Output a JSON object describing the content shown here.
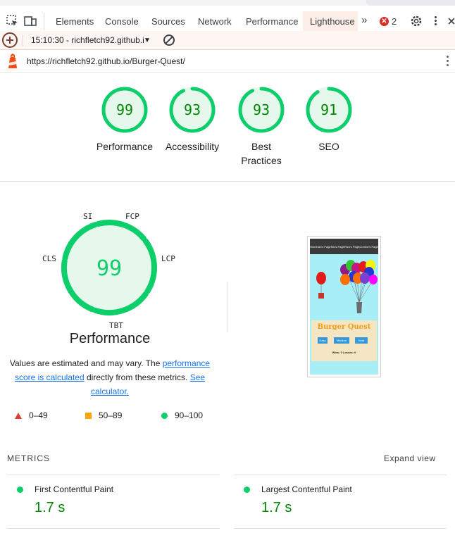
{
  "devtools": {
    "tabs": [
      "Elements",
      "Console",
      "Sources",
      "Network",
      "Performance",
      "Lighthouse"
    ],
    "active_tab": "Lighthouse",
    "more_tabs_glyph": "»",
    "error_count": "2"
  },
  "toolbar": {
    "report_select": "15:10:30 - richfletch92.github.i"
  },
  "urlbar": {
    "url": "https://richfletch92.github.io/Burger-Quest/"
  },
  "gauges": [
    {
      "score": "99",
      "label": "Performance"
    },
    {
      "score": "93",
      "label": "Accessibility"
    },
    {
      "score": "93",
      "label": "Best Practices"
    },
    {
      "score": "91",
      "label": "SEO"
    }
  ],
  "performance": {
    "score": "99",
    "title": "Performance",
    "metric_tags": {
      "si": "SI",
      "fcp": "FCP",
      "lcp": "LCP",
      "tbt": "TBT",
      "cls": "CLS"
    },
    "disclaimer_pre": "Values are estimated and may vary. The ",
    "disclaimer_link1": "performance score is calculated",
    "disclaimer_mid": " directly from these metrics. ",
    "disclaimer_link2": "See calculator."
  },
  "legend": [
    {
      "range": "0–49"
    },
    {
      "range": "50–89"
    },
    {
      "range": "90–100"
    }
  ],
  "thumbnail": {
    "nav": [
      "Home",
      "Ian's Page",
      "Nic's Page",
      "Rich's Page",
      "Gordon's Page"
    ],
    "title": "Burger Quest",
    "buttons": [
      "Easy",
      "Medium",
      "Hard"
    ],
    "stats": "Wins: 0   Losses: 0"
  },
  "metrics": {
    "section_label": "METRICS",
    "expand_label": "Expand view",
    "items": [
      {
        "name": "First Contentful Paint",
        "value": "1.7 s"
      },
      {
        "name": "Largest Contentful Paint",
        "value": "1.7 s"
      }
    ]
  },
  "colors": {
    "pass": "#0cce6b",
    "pass_text": "#008800",
    "pass_bg": "#e6f7ec",
    "average": "#ffa400",
    "fail": "#e53935",
    "link": "#1a73e8"
  }
}
